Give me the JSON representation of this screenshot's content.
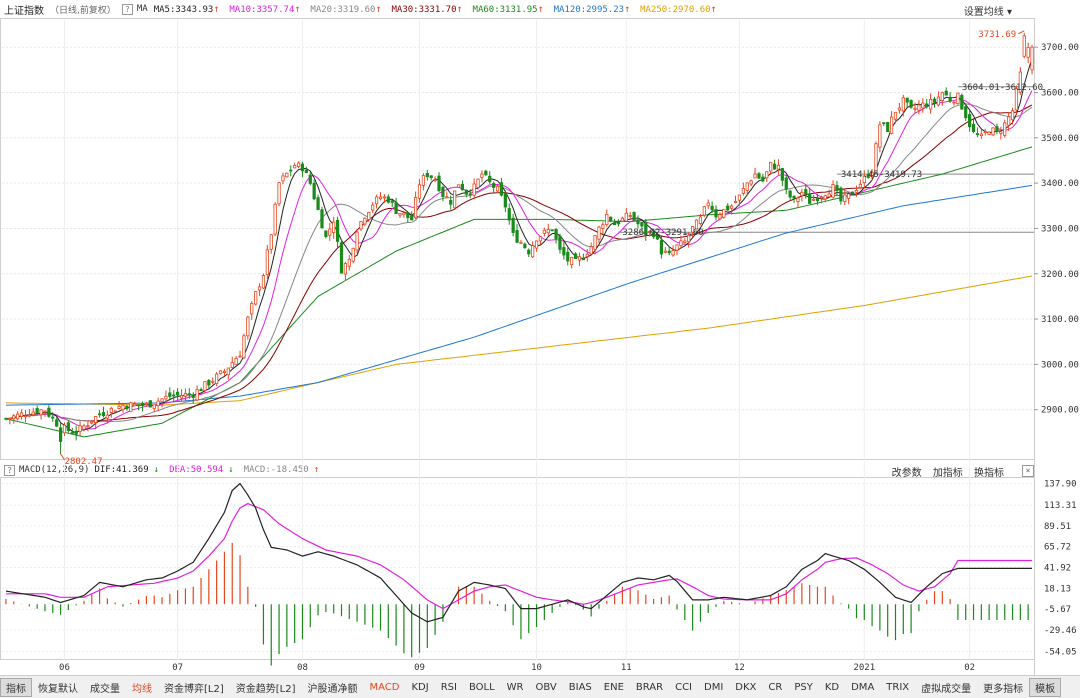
{
  "top": {
    "title": "上证指数",
    "subtitle": "（日线,前复权）",
    "help_glyph": "?",
    "ma_label": "MA",
    "ma_values": [
      {
        "text": "MA5:3343.93",
        "color": "#222222",
        "arrow": "↑",
        "arrow_color": "#e8461f"
      },
      {
        "text": "MA10:3357.74",
        "color": "#e020e0",
        "arrow": "↑",
        "arrow_color": "#e8461f"
      },
      {
        "text": "MA20:3319.60",
        "color": "#888888",
        "arrow": "↑",
        "arrow_color": "#e8461f"
      },
      {
        "text": "MA30:3331.70",
        "color": "#8b0000",
        "arrow": "↑",
        "arrow_color": "#e8461f"
      },
      {
        "text": "MA60:3131.95",
        "color": "#1a8a1a",
        "arrow": "↑",
        "arrow_color": "#e8461f"
      },
      {
        "text": "MA120:2995.23",
        "color": "#1e78d0",
        "arrow": "↑",
        "arrow_color": "#e8461f"
      },
      {
        "text": "MA250:2970.60",
        "color": "#e0a000",
        "arrow": "↑",
        "arrow_color": "#e8461f"
      }
    ],
    "settings_label": "设置均线",
    "settings_arrow": "▾"
  },
  "price_axis": {
    "ticks": [
      "3700.00",
      "3600.00",
      "3500.00",
      "3400.00",
      "3300.00",
      "3200.00",
      "3100.00",
      "3000.00",
      "2900.00"
    ]
  },
  "annotations": {
    "high": "3731.69",
    "low": "2802.47",
    "range1": "3604.01-3612.60",
    "range2": "3414.45-3419.73",
    "range3": "3286.62-3291.60"
  },
  "macd": {
    "label": "MACD(12,26,9)",
    "dif": "DIF:41.369",
    "dif_arrow": "↓",
    "dea": "DEA:50.594",
    "dea_arrow": "↓",
    "macd_val": "MACD:-18.450",
    "macd_arrow": "↑",
    "tools": [
      "改参数",
      "加指标",
      "换指标"
    ],
    "close_glyph": "×",
    "axis_ticks": [
      "137.90",
      "113.31",
      "89.51",
      "65.72",
      "41.92",
      "18.13",
      "-5.67",
      "-29.46",
      "-54.05"
    ]
  },
  "months": [
    "06",
    "07",
    "08",
    "09",
    "10",
    "11",
    "12",
    "2021",
    "02"
  ],
  "tabs": [
    {
      "label": "指标"
    },
    {
      "label": "恢复默认"
    },
    {
      "label": "成交量"
    },
    {
      "label": "均线"
    },
    {
      "label": "资金博弈[L2]"
    },
    {
      "label": "资金趋势[L2]"
    },
    {
      "label": "沪股通净额"
    },
    {
      "label": "MACD"
    },
    {
      "label": "KDJ"
    },
    {
      "label": "RSI"
    },
    {
      "label": "BOLL"
    },
    {
      "label": "WR"
    },
    {
      "label": "OBV"
    },
    {
      "label": "BIAS"
    },
    {
      "label": "ENE"
    },
    {
      "label": "BRAR"
    },
    {
      "label": "CCI"
    },
    {
      "label": "DMI"
    },
    {
      "label": "DKX"
    },
    {
      "label": "CR"
    },
    {
      "label": "PSY"
    },
    {
      "label": "KD"
    },
    {
      "label": "DMA"
    },
    {
      "label": "TRIX"
    },
    {
      "label": "虚拟成交量"
    },
    {
      "label": "更多指标"
    },
    {
      "label": "模板"
    }
  ],
  "chart_data": {
    "type": "candlestick",
    "title": "上证指数（日线,前复权）",
    "ylim": [
      2800,
      3760
    ],
    "key_points": {
      "high": 3731.69,
      "low": 2802.47
    },
    "levels": [
      3612.6,
      3419.73,
      3291.6
    ],
    "anchors": [
      [
        0,
        2880
      ],
      [
        6,
        2895
      ],
      [
        10,
        2900
      ],
      [
        14,
        2860
      ],
      [
        18,
        2850
      ],
      [
        24,
        2890
      ],
      [
        30,
        2910
      ],
      [
        36,
        2910
      ],
      [
        42,
        2930
      ],
      [
        48,
        2935
      ],
      [
        52,
        2960
      ],
      [
        56,
        2985
      ],
      [
        60,
        3025
      ],
      [
        62,
        3100
      ],
      [
        64,
        3155
      ],
      [
        66,
        3200
      ],
      [
        68,
        3290
      ],
      [
        70,
        3400
      ],
      [
        72,
        3420
      ],
      [
        74,
        3440
      ],
      [
        76,
        3435
      ],
      [
        78,
        3400
      ],
      [
        80,
        3340
      ],
      [
        82,
        3280
      ],
      [
        84,
        3320
      ],
      [
        86,
        3210
      ],
      [
        88,
        3230
      ],
      [
        90,
        3300
      ],
      [
        92,
        3330
      ],
      [
        94,
        3355
      ],
      [
        96,
        3370
      ],
      [
        98,
        3365
      ],
      [
        100,
        3340
      ],
      [
        104,
        3320
      ],
      [
        106,
        3400
      ],
      [
        108,
        3420
      ],
      [
        110,
        3410
      ],
      [
        112,
        3375
      ],
      [
        114,
        3360
      ],
      [
        116,
        3400
      ],
      [
        118,
        3380
      ],
      [
        120,
        3390
      ],
      [
        122,
        3420
      ],
      [
        124,
        3400
      ],
      [
        126,
        3385
      ],
      [
        128,
        3350
      ],
      [
        130,
        3285
      ],
      [
        132,
        3270
      ],
      [
        134,
        3250
      ],
      [
        136,
        3280
      ],
      [
        138,
        3290
      ],
      [
        140,
        3300
      ],
      [
        142,
        3250
      ],
      [
        144,
        3230
      ],
      [
        146,
        3225
      ],
      [
        148,
        3240
      ],
      [
        150,
        3260
      ],
      [
        152,
        3300
      ],
      [
        154,
        3330
      ],
      [
        156,
        3310
      ],
      [
        158,
        3320
      ],
      [
        160,
        3330
      ],
      [
        162,
        3310
      ],
      [
        164,
        3290
      ],
      [
        166,
        3290
      ],
      [
        168,
        3250
      ],
      [
        170,
        3240
      ],
      [
        172,
        3260
      ],
      [
        174,
        3270
      ],
      [
        176,
        3300
      ],
      [
        178,
        3320
      ],
      [
        180,
        3360
      ],
      [
        182,
        3330
      ],
      [
        184,
        3340
      ],
      [
        186,
        3350
      ],
      [
        188,
        3370
      ],
      [
        190,
        3400
      ],
      [
        192,
        3420
      ],
      [
        194,
        3405
      ],
      [
        196,
        3440
      ],
      [
        198,
        3435
      ],
      [
        200,
        3380
      ],
      [
        202,
        3360
      ],
      [
        204,
        3380
      ],
      [
        206,
        3360
      ],
      [
        208,
        3370
      ],
      [
        210,
        3380
      ],
      [
        212,
        3390
      ],
      [
        214,
        3360
      ],
      [
        216,
        3370
      ],
      [
        218,
        3390
      ],
      [
        220,
        3410
      ],
      [
        222,
        3430
      ],
      [
        224,
        3530
      ],
      [
        226,
        3520
      ],
      [
        228,
        3560
      ],
      [
        230,
        3580
      ],
      [
        232,
        3560
      ],
      [
        234,
        3570
      ],
      [
        236,
        3575
      ],
      [
        238,
        3580
      ],
      [
        240,
        3600
      ],
      [
        242,
        3585
      ],
      [
        244,
        3590
      ],
      [
        246,
        3550
      ],
      [
        248,
        3510
      ],
      [
        250,
        3500
      ],
      [
        252,
        3520
      ],
      [
        254,
        3510
      ],
      [
        256,
        3530
      ],
      [
        258,
        3560
      ],
      [
        260,
        3640
      ],
      [
        262,
        3700
      ],
      [
        263,
        3700
      ]
    ],
    "ma_anchors": {
      "ma60": [
        [
          0,
          2880
        ],
        [
          20,
          2840
        ],
        [
          40,
          2870
        ],
        [
          60,
          2960
        ],
        [
          80,
          3150
        ],
        [
          100,
          3250
        ],
        [
          120,
          3320
        ],
        [
          140,
          3320
        ],
        [
          160,
          3315
        ],
        [
          180,
          3330
        ],
        [
          200,
          3340
        ],
        [
          220,
          3380
        ],
        [
          240,
          3420
        ],
        [
          263,
          3480
        ]
      ],
      "ma120": [
        [
          0,
          2910
        ],
        [
          40,
          2915
        ],
        [
          60,
          2930
        ],
        [
          80,
          2960
        ],
        [
          120,
          3060
        ],
        [
          160,
          3180
        ],
        [
          200,
          3290
        ],
        [
          230,
          3350
        ],
        [
          263,
          3395
        ]
      ],
      "ma250": [
        [
          0,
          2915
        ],
        [
          40,
          2910
        ],
        [
          60,
          2920
        ],
        [
          100,
          3000
        ],
        [
          140,
          3040
        ],
        [
          180,
          3080
        ],
        [
          220,
          3130
        ],
        [
          263,
          3195
        ]
      ]
    },
    "macd_anchors": {
      "dif": [
        [
          0,
          15
        ],
        [
          10,
          8
        ],
        [
          14,
          2
        ],
        [
          20,
          10
        ],
        [
          24,
          25
        ],
        [
          30,
          20
        ],
        [
          36,
          28
        ],
        [
          40,
          30
        ],
        [
          44,
          38
        ],
        [
          48,
          48
        ],
        [
          52,
          75
        ],
        [
          56,
          105
        ],
        [
          58,
          130
        ],
        [
          60,
          138
        ],
        [
          62,
          125
        ],
        [
          64,
          110
        ],
        [
          66,
          85
        ],
        [
          68,
          65
        ],
        [
          72,
          62
        ],
        [
          76,
          55
        ],
        [
          80,
          60
        ],
        [
          84,
          55
        ],
        [
          90,
          45
        ],
        [
          96,
          30
        ],
        [
          100,
          10
        ],
        [
          104,
          -10
        ],
        [
          108,
          -20
        ],
        [
          112,
          -15
        ],
        [
          116,
          15
        ],
        [
          120,
          25
        ],
        [
          124,
          22
        ],
        [
          128,
          18
        ],
        [
          132,
          -5
        ],
        [
          136,
          -5
        ],
        [
          140,
          0
        ],
        [
          144,
          5
        ],
        [
          148,
          -3
        ],
        [
          150,
          -5
        ],
        [
          154,
          10
        ],
        [
          158,
          25
        ],
        [
          162,
          30
        ],
        [
          166,
          28
        ],
        [
          170,
          33
        ],
        [
          172,
          26
        ],
        [
          176,
          5
        ],
        [
          180,
          5
        ],
        [
          184,
          8
        ],
        [
          190,
          5
        ],
        [
          196,
          10
        ],
        [
          200,
          20
        ],
        [
          204,
          40
        ],
        [
          208,
          50
        ],
        [
          210,
          58
        ],
        [
          212,
          55
        ],
        [
          216,
          50
        ],
        [
          220,
          40
        ],
        [
          224,
          25
        ],
        [
          228,
          8
        ],
        [
          232,
          2
        ],
        [
          236,
          20
        ],
        [
          240,
          35
        ],
        [
          244,
          41
        ]
      ],
      "dea": [
        [
          0,
          12
        ],
        [
          10,
          12
        ],
        [
          14,
          8
        ],
        [
          20,
          8
        ],
        [
          26,
          20
        ],
        [
          32,
          22
        ],
        [
          38,
          24
        ],
        [
          44,
          30
        ],
        [
          48,
          38
        ],
        [
          52,
          55
        ],
        [
          56,
          75
        ],
        [
          58,
          95
        ],
        [
          60,
          110
        ],
        [
          62,
          115
        ],
        [
          66,
          108
        ],
        [
          70,
          92
        ],
        [
          76,
          75
        ],
        [
          82,
          62
        ],
        [
          90,
          55
        ],
        [
          96,
          45
        ],
        [
          102,
          28
        ],
        [
          108,
          5
        ],
        [
          112,
          -5
        ],
        [
          116,
          5
        ],
        [
          120,
          15
        ],
        [
          124,
          20
        ],
        [
          128,
          22
        ],
        [
          132,
          15
        ],
        [
          136,
          8
        ],
        [
          140,
          5
        ],
        [
          144,
          3
        ],
        [
          148,
          0
        ],
        [
          150,
          2
        ],
        [
          154,
          8
        ],
        [
          158,
          15
        ],
        [
          162,
          22
        ],
        [
          166,
          25
        ],
        [
          170,
          28
        ],
        [
          172,
          29
        ],
        [
          176,
          20
        ],
        [
          180,
          10
        ],
        [
          184,
          6
        ],
        [
          190,
          5
        ],
        [
          196,
          5
        ],
        [
          200,
          12
        ],
        [
          204,
          28
        ],
        [
          208,
          40
        ],
        [
          210,
          48
        ],
        [
          214,
          52
        ],
        [
          218,
          53
        ],
        [
          222,
          45
        ],
        [
          226,
          35
        ],
        [
          230,
          22
        ],
        [
          234,
          15
        ],
        [
          238,
          20
        ],
        [
          242,
          35
        ],
        [
          244,
          50
        ]
      ]
    }
  }
}
